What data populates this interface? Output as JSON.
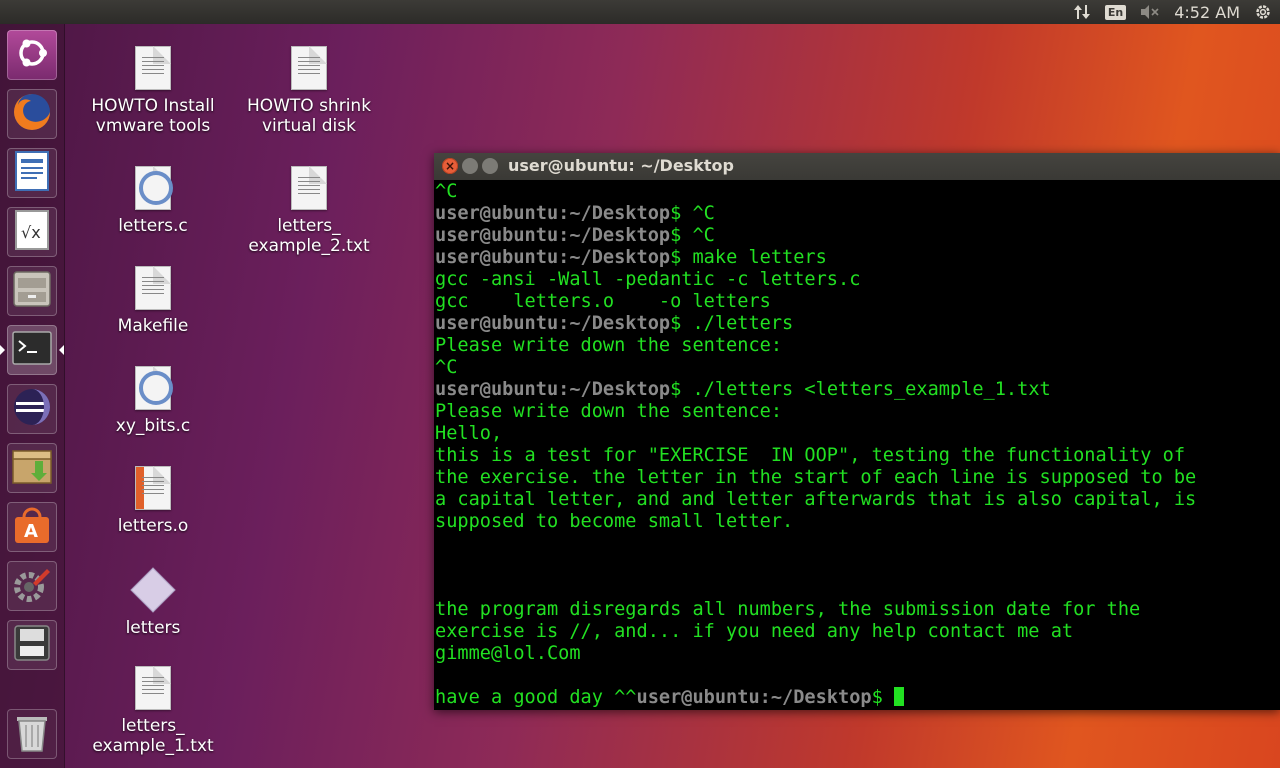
{
  "top_panel": {
    "keyboard_layout": "En",
    "clock": "4:52 AM"
  },
  "launcher": {
    "items": [
      {
        "name": "ubuntu-dash",
        "icon": "ubuntu-logo-icon"
      },
      {
        "name": "firefox",
        "icon": "firefox-icon"
      },
      {
        "name": "libreoffice-writer",
        "icon": "writer-icon"
      },
      {
        "name": "libreoffice-math",
        "icon": "math-icon"
      },
      {
        "name": "files",
        "icon": "file-cabinet-icon"
      },
      {
        "name": "terminal",
        "icon": "terminal-icon"
      },
      {
        "name": "eclipse",
        "icon": "eclipse-icon"
      },
      {
        "name": "archive-manager",
        "icon": "archive-icon"
      },
      {
        "name": "software-center",
        "icon": "software-store-icon"
      },
      {
        "name": "system-settings",
        "icon": "settings-wrench-icon"
      },
      {
        "name": "disks",
        "icon": "disk-icon"
      },
      {
        "name": "trash",
        "icon": "trash-icon"
      }
    ]
  },
  "desktop": {
    "icons": [
      {
        "label": "HOWTO Install\nvmware tools",
        "type": "text"
      },
      {
        "label": "HOWTO shrink\nvirtual disk",
        "type": "text"
      },
      {
        "label": "letters.c",
        "type": "c-source"
      },
      {
        "label": "letters_\nexample_2.txt",
        "type": "text"
      },
      {
        "label": "Makefile",
        "type": "text"
      },
      {
        "label": "xy_bits.c",
        "type": "c-source"
      },
      {
        "label": "letters.o",
        "type": "object"
      },
      {
        "label": "letters",
        "type": "executable"
      },
      {
        "label": "letters_\nexample_1.txt",
        "type": "text"
      }
    ]
  },
  "terminal": {
    "title": "user@ubuntu: ~/Desktop",
    "prompt_user": "user@ubuntu",
    "prompt_path": ":~/Desktop",
    "prompt_sign": "$",
    "lines": [
      {
        "text": "^C"
      },
      {
        "prompt": true,
        "cmd": " ^C"
      },
      {
        "prompt": true,
        "cmd": " ^C"
      },
      {
        "prompt": true,
        "cmd": " make letters"
      },
      {
        "text": "gcc -ansi -Wall -pedantic -c letters.c"
      },
      {
        "text": "gcc    letters.o    -o letters"
      },
      {
        "prompt": true,
        "cmd": " ./letters"
      },
      {
        "text": "Please write down the sentence:"
      },
      {
        "text": "^C"
      },
      {
        "prompt": true,
        "cmd": " ./letters <letters_example_1.txt"
      },
      {
        "text": "Please write down the sentence:"
      },
      {
        "text": "Hello,"
      },
      {
        "text": "this is a test for \"EXERCISE  IN OOP\", testing the functionality of"
      },
      {
        "text": "the exercise. the letter in the start of each line is supposed to be"
      },
      {
        "text": "a capital letter, and and letter afterwards that is also capital, is"
      },
      {
        "text": "supposed to become small letter."
      },
      {
        "text": ""
      },
      {
        "text": ""
      },
      {
        "text": ""
      },
      {
        "text": "the program disregards all numbers, the submission date for the"
      },
      {
        "text": "exercise is //, and... if you need any help contact me at"
      },
      {
        "text": "gimme@lol.Com"
      },
      {
        "text": ""
      },
      {
        "text": "have a good day ^^",
        "trailing_prompt": true
      }
    ]
  }
}
